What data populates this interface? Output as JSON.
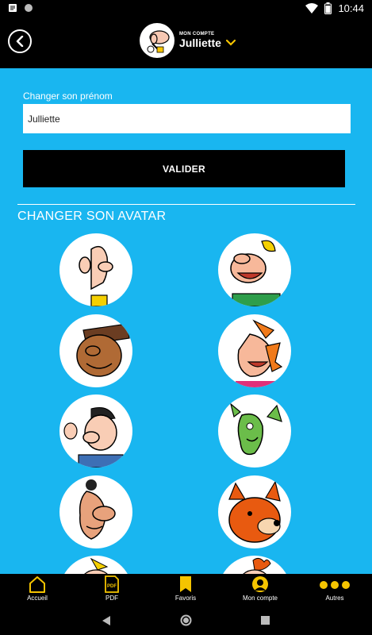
{
  "status_bar": {
    "time": "10:44"
  },
  "header": {
    "caption": "MON COMPTE",
    "name": "Julliette"
  },
  "form": {
    "label": "Changer son prénom",
    "value": "Julliette",
    "submit_label": "VALIDER"
  },
  "avatar_section": {
    "title": "CHANGER SON AVATAR"
  },
  "bottom_nav": [
    {
      "label": "Accueil",
      "icon": "home-icon"
    },
    {
      "label": "PDF",
      "icon": "pdf-icon"
    },
    {
      "label": "Favoris",
      "icon": "bookmark-icon"
    },
    {
      "label": "Mon compte",
      "icon": "account-icon"
    },
    {
      "label": "Autres",
      "icon": "more-icon"
    }
  ],
  "pdf_icon_text": "PDF",
  "colors": {
    "accent": "#f5c400",
    "background": "#19b6f0",
    "bar": "#000000"
  }
}
